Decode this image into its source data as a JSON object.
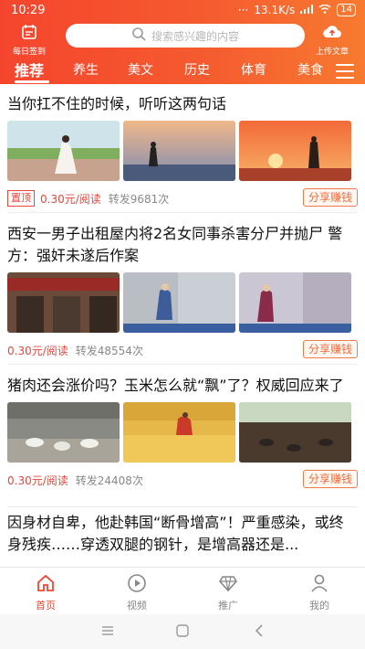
{
  "status": {
    "time": "10:29",
    "dots": "···",
    "speed": "13.1K/s",
    "battery": "14"
  },
  "header": {
    "signin_label": "每日签到",
    "search_placeholder": "搜索感兴趣的内容",
    "upload_label": "上传文章",
    "tabs": [
      "推荐",
      "养生",
      "美文",
      "历史",
      "体育",
      "美食"
    ]
  },
  "colors": {
    "brand": "#f5452e",
    "accent": "#e8463b",
    "share": "#f06a3a"
  },
  "articles": [
    {
      "title": "当你扛不住的时候，听听这两句话",
      "tag": "置顶",
      "price": "0.30元/阅读",
      "shares": "转发9681次",
      "share_label": "分享赚钱"
    },
    {
      "title": "西安一男子出租屋内将2名女同事杀害分尸并抛尸 警方：强奸未遂后作案",
      "price": "0.30元/阅读",
      "shares": "转发48554次",
      "share_label": "分享赚钱"
    },
    {
      "title": "猪肉还会涨价吗？玉米怎么就“飘”了？权威回应来了",
      "price": "0.30元/阅读",
      "shares": "转发24408次",
      "share_label": "分享赚钱"
    },
    {
      "title": "因身材自卑，他赴韩国“断骨增高”！严重感染，或终身残疾……穿透双腿的钢针，是增高器还是..."
    }
  ],
  "bottom_nav": [
    "首页",
    "视频",
    "推广",
    "我的"
  ]
}
